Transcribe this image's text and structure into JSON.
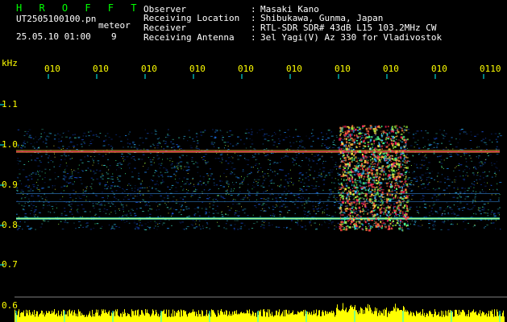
{
  "header": {
    "title": "H R O F F T",
    "filename": "UT2505100100.pn",
    "mode": "meteor",
    "datetime": "25.05.10 01:00",
    "page": "9"
  },
  "meta": {
    "observer": {
      "key": "Observer",
      "value": "Masaki Kano"
    },
    "location": {
      "key": "Receiving Location",
      "value": "Shibukawa, Gunma, Japan"
    },
    "receiver": {
      "key": "Receiver",
      "value": "RTL-SDR SDR# 43dB L15 103.2MHz CW"
    },
    "antenna": {
      "key": "Receiving Antenna",
      "value": "3el Yagi(V) Az 330 for Vladivostok"
    }
  },
  "axis": {
    "y_unit": "kHz",
    "y_ticks": [
      "1.1",
      "1.0",
      "0.9",
      "0.8",
      "0.7",
      "0.6"
    ],
    "time_ticks": [
      "010",
      "010",
      "010",
      "010",
      "010",
      "010",
      "010",
      "010",
      "010",
      "0110"
    ]
  },
  "colors": {
    "background": "#000000",
    "text": "#ffffff",
    "title": "#00ff00",
    "axis_labels": "#ffff00",
    "level_bars": "#ffff00",
    "tick_marks": "#00ffff"
  }
}
